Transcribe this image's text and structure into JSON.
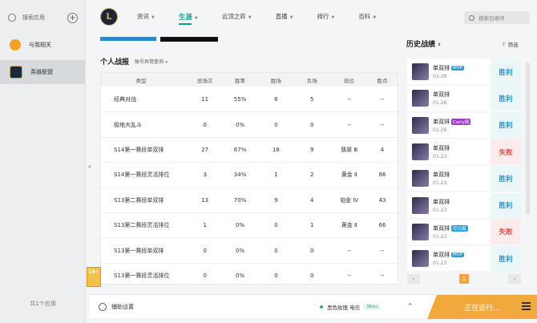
{
  "sidebar": {
    "search_label": "搜索应用",
    "items": [
      {
        "label": "与我相关"
      },
      {
        "label": "英雄联盟"
      }
    ],
    "app_count": "共1个应用"
  },
  "nav": {
    "tabs": [
      {
        "label": "资讯"
      },
      {
        "label": "生涯"
      },
      {
        "label": "云顶之弈"
      },
      {
        "label": "直播"
      },
      {
        "label": "排行"
      },
      {
        "label": "百科"
      }
    ],
    "search_placeholder": "搜索召唤师",
    "logo": "L"
  },
  "record": {
    "title": "个人战报",
    "subtitle": "账号异常查询 »",
    "headers": [
      "类型",
      "总场次",
      "胜率",
      "胜场",
      "负场",
      "段位",
      "胜点"
    ],
    "rows": [
      [
        "经典对战",
        "11",
        "55%",
        "6",
        "5",
        "--",
        "--"
      ],
      [
        "极地大乱斗",
        "0",
        "0%",
        "0",
        "0",
        "--",
        "--"
      ],
      [
        "S14第一赛段单双排",
        "27",
        "67%",
        "18",
        "9",
        "翡翠 Ⅲ",
        "4"
      ],
      [
        "S14第一赛段灵活排位",
        "3",
        "34%",
        "1",
        "2",
        "黄金 Ⅱ",
        "66"
      ],
      [
        "S13第二赛段单双排",
        "13",
        "70%",
        "9",
        "4",
        "铂金 Ⅳ",
        "43"
      ],
      [
        "S13第二赛段灵活排位",
        "1",
        "0%",
        "0",
        "1",
        "黄金 Ⅱ",
        "66"
      ],
      [
        "S13第一赛段单双排",
        "0",
        "0%",
        "0",
        "0",
        "--",
        "--"
      ],
      [
        "S13第一赛段灵活排位",
        "0",
        "0%",
        "0",
        "0",
        "--",
        "--"
      ]
    ]
  },
  "history": {
    "title": "历史战绩 ›",
    "filter": "筛选",
    "page": "1",
    "games": [
      {
        "mode": "单双排",
        "tag": "MVP",
        "tagtype": "mvp",
        "date": "01-26",
        "result": "胜利",
        "win": true
      },
      {
        "mode": "单双排",
        "tag": "",
        "tagtype": "",
        "date": "01-26",
        "result": "胜利",
        "win": true
      },
      {
        "mode": "单双排",
        "tag": "Carry局",
        "tagtype": "carry",
        "date": "01-26",
        "result": "胜利",
        "win": true
      },
      {
        "mode": "单双排",
        "tag": "",
        "tagtype": "",
        "date": "01-23",
        "result": "失败",
        "win": false
      },
      {
        "mode": "单双排",
        "tag": "",
        "tagtype": "",
        "date": "01-23",
        "result": "胜利",
        "win": true
      },
      {
        "mode": "单双排",
        "tag": "",
        "tagtype": "",
        "date": "01-23",
        "result": "胜利",
        "win": true
      },
      {
        "mode": "单双排",
        "tag": "尽力局",
        "tagtype": "hard",
        "date": "01-23",
        "result": "失败",
        "win": false
      },
      {
        "mode": "单双排",
        "tag": "MVP",
        "tagtype": "mvp",
        "date": "01-23",
        "result": "胜利",
        "win": true
      }
    ]
  },
  "age_badge": "16+",
  "bottom": {
    "assist": "辅助设置",
    "server": "黑色玫瑰 电信",
    "ping": "38ms",
    "running": "正在运行..."
  },
  "colors": {
    "accent": "#159b8a",
    "win": "#2b94c7",
    "lose": "#d9534f",
    "run": "#f2a93b"
  }
}
